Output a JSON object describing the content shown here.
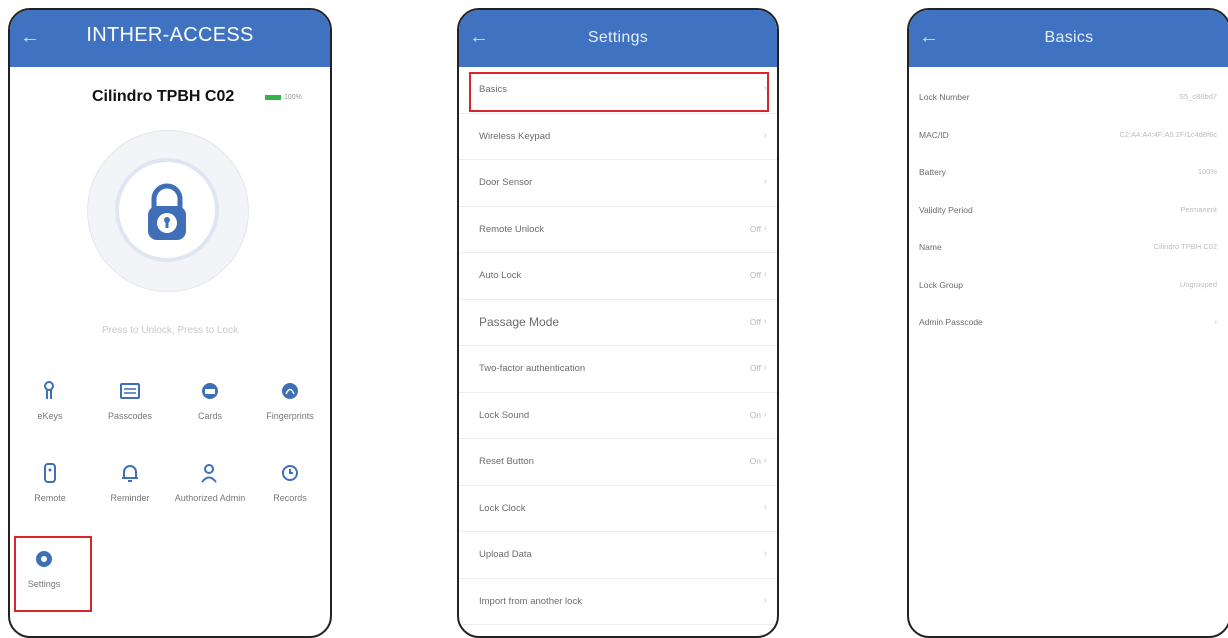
{
  "colors": {
    "header": "#3f72c0",
    "accent": "#3f6fb6",
    "highlight": "#d9262c",
    "battery": "#35b34a"
  },
  "phone1": {
    "title": "INTHER-ACCESS",
    "lock_name": "Cilindro TPBH C02",
    "battery": "100%",
    "hint": "Press to Unlock, Press to Lock",
    "row1": [
      "eKeys",
      "Passcodes",
      "Cards",
      "Fingerprints"
    ],
    "row2": [
      "Remote",
      "Reminder",
      "Authorized Admin",
      "Records"
    ],
    "row3": [
      "Settings"
    ]
  },
  "phone2": {
    "title": "Settings",
    "items": [
      {
        "label": "Basics",
        "value": ""
      },
      {
        "label": "Wireless Keypad",
        "value": ""
      },
      {
        "label": "Door Sensor",
        "value": ""
      },
      {
        "label": "Remote Unlock",
        "value": "Off"
      },
      {
        "label": "Auto Lock",
        "value": "Off"
      },
      {
        "label": "Passage Mode",
        "value": "Off"
      },
      {
        "label": "Two-factor authentication",
        "value": "Off"
      },
      {
        "label": "Lock Sound",
        "value": "On"
      },
      {
        "label": "Reset Button",
        "value": "On"
      },
      {
        "label": "Lock Clock",
        "value": ""
      },
      {
        "label": "Upload Data",
        "value": ""
      },
      {
        "label": "Import from another lock",
        "value": ""
      }
    ]
  },
  "phone3": {
    "title": "Basics",
    "items": [
      {
        "label": "Lock Number",
        "value": "S5_c86bd7"
      },
      {
        "label": "MAC/ID",
        "value": "C2:A4:A4:4F:A5:2F/1c4d8f6c"
      },
      {
        "label": "Battery",
        "value": "100%"
      },
      {
        "label": "Validity Period",
        "value": "Permanent"
      },
      {
        "label": "Name",
        "value": "Cilindro TPBH C02"
      },
      {
        "label": "Lock Group",
        "value": "Ungrouped"
      },
      {
        "label": "Admin Passcode",
        "value": ""
      }
    ]
  }
}
